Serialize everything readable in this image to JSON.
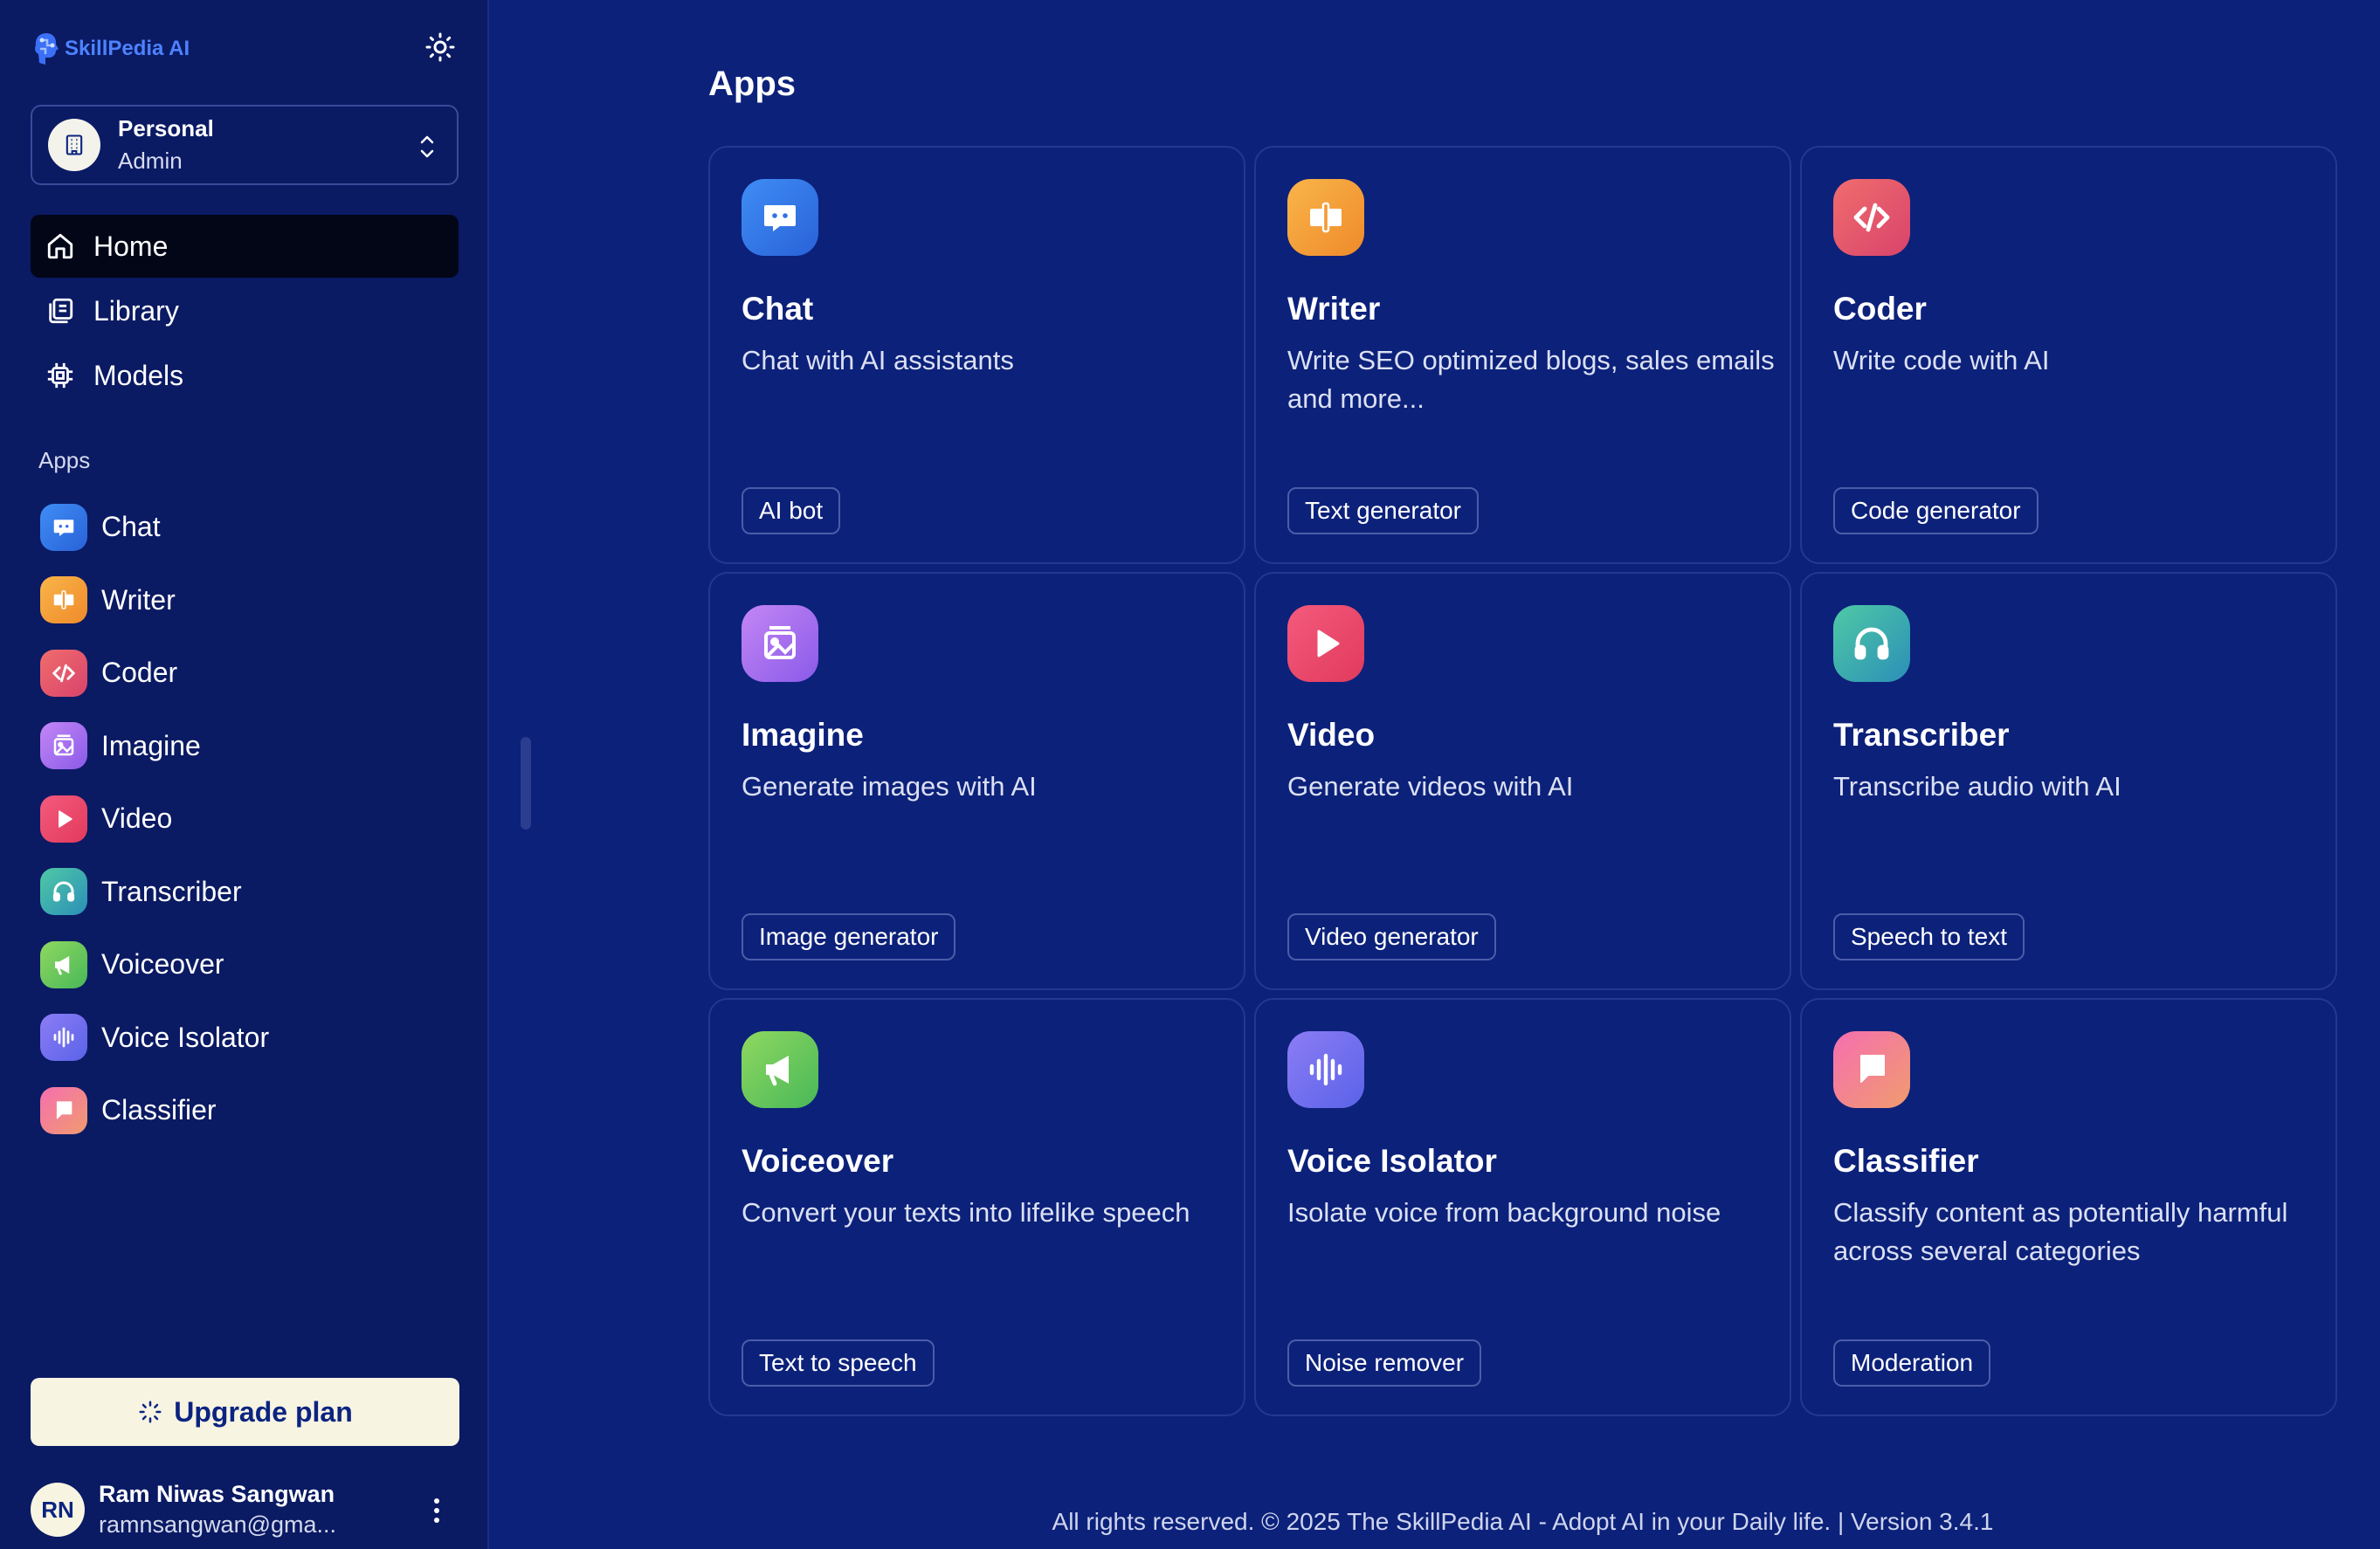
{
  "brand": {
    "name": "SkillPedia AI",
    "color": "#4d82ff"
  },
  "workspace": {
    "name": "Personal",
    "role": "Admin"
  },
  "nav": [
    {
      "label": "Home",
      "icon": "home-icon",
      "active": true
    },
    {
      "label": "Library",
      "icon": "library-icon"
    },
    {
      "label": "Models",
      "icon": "chip-icon"
    }
  ],
  "sidebar_apps_heading": "Apps",
  "apps": [
    {
      "label": "Chat",
      "icon": "chat-bubble-icon",
      "color": "#3f8df5"
    },
    {
      "label": "Writer",
      "icon": "presenter-icon",
      "color": "#f9b54a"
    },
    {
      "label": "Coder",
      "icon": "code-icon",
      "color": "#f06d6d"
    },
    {
      "label": "Imagine",
      "icon": "image-icon",
      "color": "#c386f5"
    },
    {
      "label": "Video",
      "icon": "play-icon",
      "color": "#f45a7d"
    },
    {
      "label": "Transcriber",
      "icon": "headphones-icon",
      "color": "#4fc9a5"
    },
    {
      "label": "Voiceover",
      "icon": "megaphone-icon",
      "color": "#8fd860"
    },
    {
      "label": "Voice Isolator",
      "icon": "waveform-icon",
      "color": "#8c7cf5"
    },
    {
      "label": "Classifier",
      "icon": "flag-icon",
      "color": "#f56fb0"
    }
  ],
  "upgrade_label": "Upgrade plan",
  "user": {
    "initials": "RN",
    "name": "Ram Niwas Sangwan",
    "email": "ramnsangwan@gma..."
  },
  "main": {
    "title": "Apps",
    "cards": [
      {
        "title": "Chat",
        "desc": "Chat with AI assistants",
        "tag": "AI bot"
      },
      {
        "title": "Writer",
        "desc": "Write SEO optimized blogs, sales emails and more...",
        "tag": "Text generator"
      },
      {
        "title": "Coder",
        "desc": "Write code with AI",
        "tag": "Code generator"
      },
      {
        "title": "Imagine",
        "desc": "Generate images with AI",
        "tag": "Image generator"
      },
      {
        "title": "Video",
        "desc": "Generate videos with AI",
        "tag": "Video generator"
      },
      {
        "title": "Transcriber",
        "desc": "Transcribe audio with AI",
        "tag": "Speech to text"
      },
      {
        "title": "Voiceover",
        "desc": "Convert your texts into lifelike speech",
        "tag": "Text to speech"
      },
      {
        "title": "Voice Isolator",
        "desc": "Isolate voice from background noise",
        "tag": "Noise remover"
      },
      {
        "title": "Classifier",
        "desc": "Classify content as potentially harmful across several categories",
        "tag": "Moderation"
      }
    ]
  },
  "footer": "All rights reserved. © 2025 The SkillPedia AI - Adopt AI in your Daily life. | Version 3.4.1"
}
